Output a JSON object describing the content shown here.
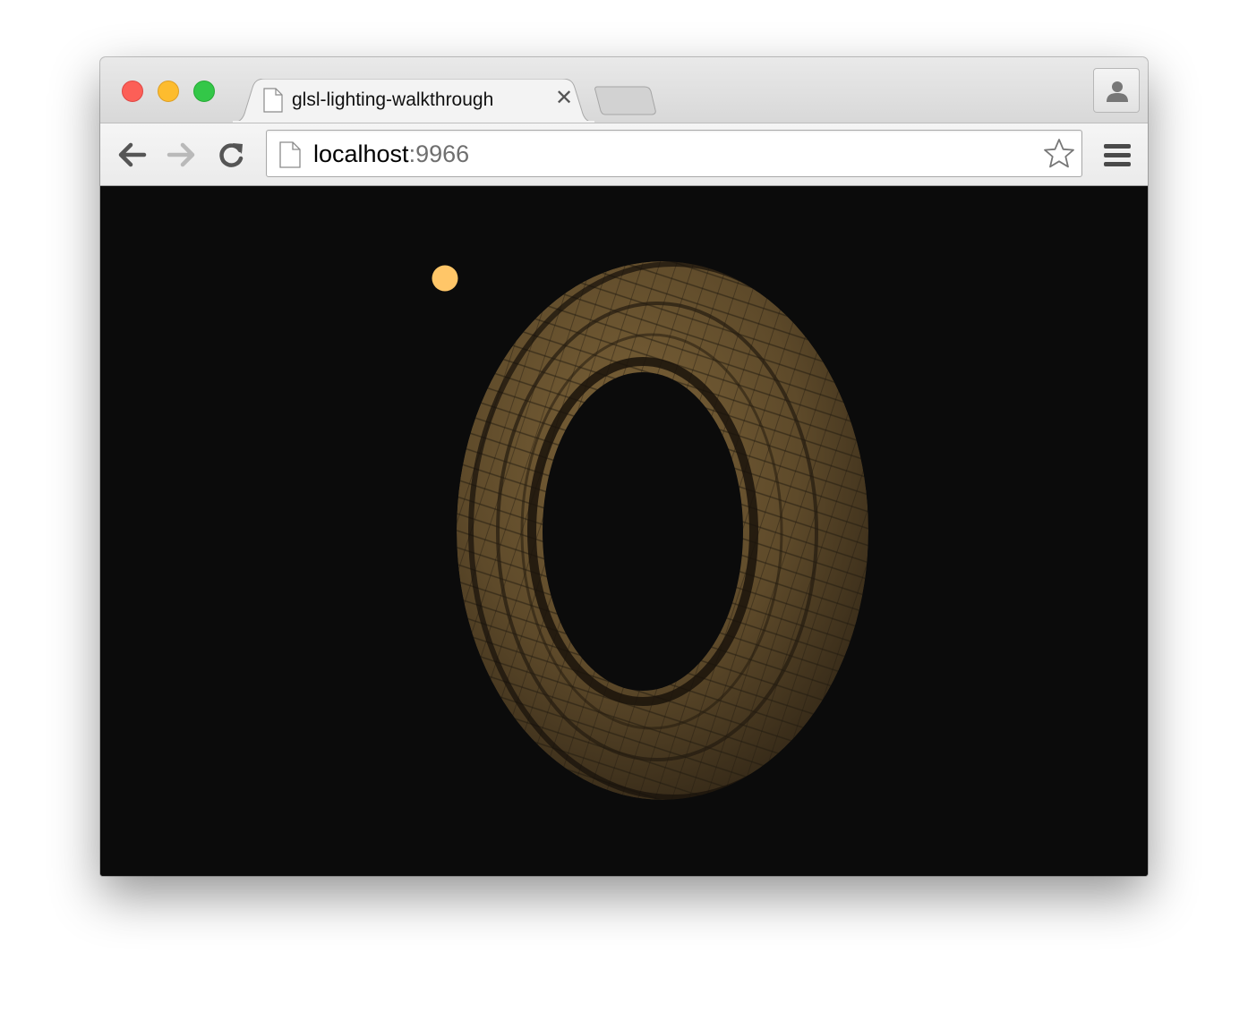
{
  "tab": {
    "title": "glsl-lighting-walkthrough",
    "close_glyph": "✕",
    "icon": "page-icon"
  },
  "toolbar": {
    "back_icon": "arrow-left-icon",
    "forward_icon": "arrow-right-icon",
    "reload_icon": "reload-icon",
    "menu_icon": "hamburger-menu-icon",
    "profile_icon": "person-icon"
  },
  "address_bar": {
    "host": "localhost",
    "port": ":9966",
    "bookmark_icon": "star-icon"
  },
  "scene": {
    "background_color": "#0b0b0b",
    "light_color": "#ffc668",
    "model_color": "#6b5532",
    "model": "torus-tire-icon",
    "light": "light-source-icon"
  },
  "colors": {
    "traffic_close": "#fc5f57",
    "traffic_minimize": "#fdbc2e",
    "traffic_maximize": "#33c748"
  }
}
